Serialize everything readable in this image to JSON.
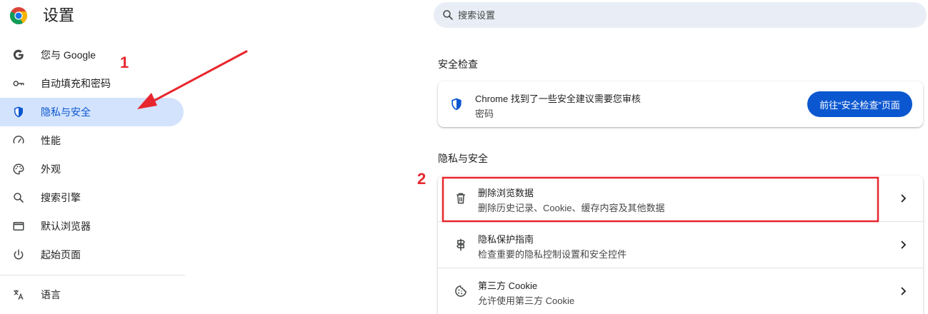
{
  "header": {
    "title": "设置",
    "search_placeholder": "搜索设置"
  },
  "sidebar": {
    "items": [
      {
        "label": "您与 Google",
        "icon": "google-g-icon"
      },
      {
        "label": "自动填充和密码",
        "icon": "key-icon"
      },
      {
        "label": "隐私与安全",
        "icon": "shield-icon",
        "active": true
      },
      {
        "label": "性能",
        "icon": "speedometer-icon"
      },
      {
        "label": "外观",
        "icon": "palette-icon"
      },
      {
        "label": "搜索引擎",
        "icon": "search-icon"
      },
      {
        "label": "默认浏览器",
        "icon": "browser-window-icon"
      },
      {
        "label": "起始页面",
        "icon": "power-icon"
      },
      {
        "label": "语言",
        "icon": "translate-icon"
      }
    ]
  },
  "safety_check": {
    "section_title": "安全检查",
    "title": "Chrome 找到了一些安全建议需要您审核",
    "subtitle": "密码",
    "button_label": "前往“安全检查”页面"
  },
  "privacy": {
    "section_title": "隐私与安全",
    "rows": [
      {
        "title": "删除浏览数据",
        "subtitle": "删除历史记录、Cookie、缓存内容及其他数据",
        "icon": "trash-icon"
      },
      {
        "title": "隐私保护指南",
        "subtitle": "检查重要的隐私控制设置和安全控件",
        "icon": "signpost-icon"
      },
      {
        "title": "第三方 Cookie",
        "subtitle": "允许使用第三方 Cookie",
        "icon": "cookie-icon"
      }
    ]
  },
  "annotations": {
    "step1": "1",
    "step2": "2",
    "color": "#e8262e"
  },
  "colors": {
    "accent": "#0b57d0",
    "active_bg": "#d3e3fd",
    "search_bg": "#e9eef6"
  }
}
